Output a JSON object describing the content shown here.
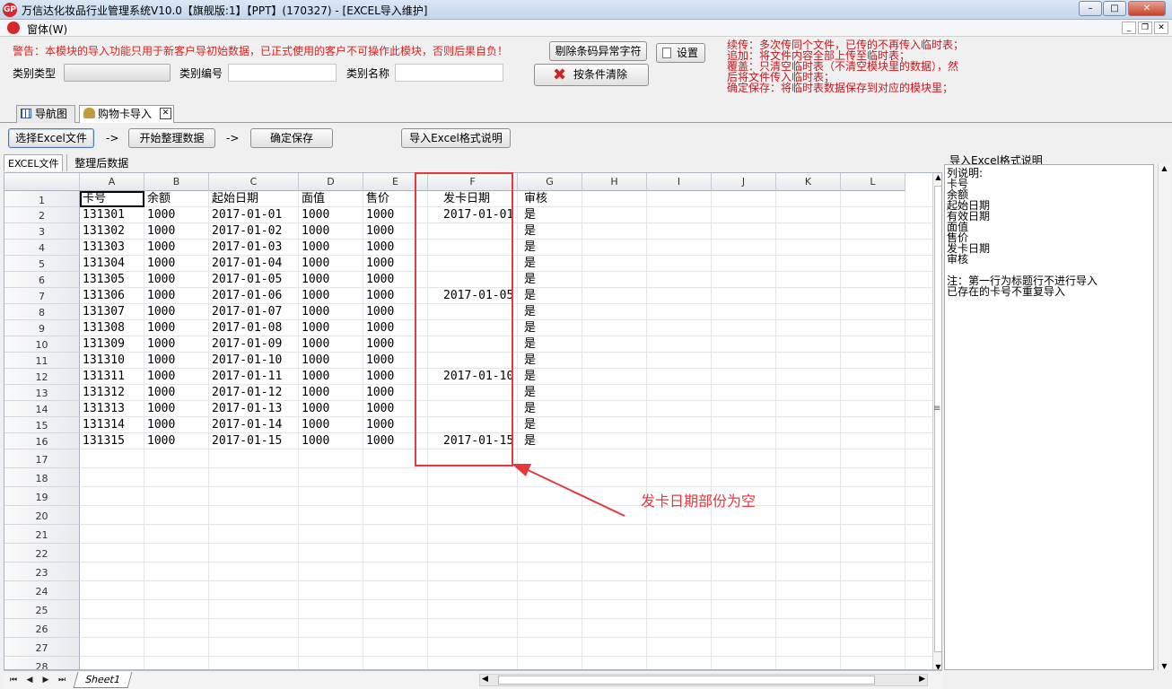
{
  "window": {
    "logo_text": "GP",
    "title": "万信达化妆品行业管理系统V10.0【旗舰版:1】【PPT】(170327) - [EXCEL导入维护]",
    "min": "–",
    "max": "□",
    "close": "✕"
  },
  "menubar": {
    "item": "窗体(W)",
    "mdi_min": "_",
    "mdi_restore": "❐",
    "mdi_close": "✕"
  },
  "header": {
    "warning": "警告：本模块的导入功能只用于新客户导初始数据，已正式使用的客户不可操作此模块，否则后果自负！",
    "category_type_label": "类别类型",
    "category_code_label": "类别编号",
    "category_name_label": "类别名称",
    "btn_remove_abnormal": "剔除条码异常字符",
    "btn_settings": "设置",
    "btn_clear": "按条件清除",
    "notes": [
      "续传：多次传同个文件，已传的不再传入临时表；",
      "追加：将文件内容全部上传至临时表；",
      "覆盖：只清空临时表（不清空模块里的数据），然",
      "后将文件传入临时表；",
      "确定保存：将临时表数据保存到对应的模块里；"
    ]
  },
  "tabs": [
    {
      "label": "导航图"
    },
    {
      "label": "购物卡导入"
    }
  ],
  "toolbar": {
    "select_excel": "选择Excel文件",
    "arrow1": "->",
    "start_organize": "开始整理数据",
    "arrow2": "->",
    "confirm_save": "确定保存",
    "format_help": "导入Excel格式说明"
  },
  "subtabs": {
    "excel_file": "EXCEL文件",
    "organized": "整理后数据"
  },
  "sheet": {
    "columns": [
      "A",
      "B",
      "C",
      "D",
      "E",
      "F",
      "G",
      "H",
      "I",
      "J",
      "K",
      "L"
    ],
    "row_numbers": [
      "1",
      "2",
      "3",
      "4",
      "5",
      "6",
      "7",
      "8",
      "9",
      "10",
      "11",
      "12",
      "13",
      "14",
      "15",
      "16",
      "17",
      "18",
      "19",
      "20",
      "21",
      "22",
      "23",
      "24",
      "25",
      "26",
      "27",
      "28"
    ],
    "rows": [
      [
        "卡号",
        "余额",
        "起始日期",
        "面值",
        "售价",
        "发卡日期",
        "审核"
      ],
      [
        "131301",
        "1000",
        "2017-01-01",
        "1000",
        "1000",
        "2017-01-01",
        "是"
      ],
      [
        "131302",
        "1000",
        "2017-01-02",
        "1000",
        "1000",
        "",
        "是"
      ],
      [
        "131303",
        "1000",
        "2017-01-03",
        "1000",
        "1000",
        "",
        "是"
      ],
      [
        "131304",
        "1000",
        "2017-01-04",
        "1000",
        "1000",
        "",
        "是"
      ],
      [
        "131305",
        "1000",
        "2017-01-05",
        "1000",
        "1000",
        "",
        "是"
      ],
      [
        "131306",
        "1000",
        "2017-01-06",
        "1000",
        "1000",
        "2017-01-05",
        "是"
      ],
      [
        "131307",
        "1000",
        "2017-01-07",
        "1000",
        "1000",
        "",
        "是"
      ],
      [
        "131308",
        "1000",
        "2017-01-08",
        "1000",
        "1000",
        "",
        "是"
      ],
      [
        "131309",
        "1000",
        "2017-01-09",
        "1000",
        "1000",
        "",
        "是"
      ],
      [
        "131310",
        "1000",
        "2017-01-10",
        "1000",
        "1000",
        "",
        "是"
      ],
      [
        "131311",
        "1000",
        "2017-01-11",
        "1000",
        "1000",
        "2017-01-10",
        "是"
      ],
      [
        "131312",
        "1000",
        "2017-01-12",
        "1000",
        "1000",
        "",
        "是"
      ],
      [
        "131313",
        "1000",
        "2017-01-13",
        "1000",
        "1000",
        "",
        "是"
      ],
      [
        "131314",
        "1000",
        "2017-01-14",
        "1000",
        "1000",
        "",
        "是"
      ],
      [
        "131315",
        "1000",
        "2017-01-15",
        "1000",
        "1000",
        "2017-01-15",
        "是"
      ]
    ],
    "sheet_tab": "Sheet1",
    "nav": [
      "⏮",
      "◀",
      "▶",
      "⏭"
    ]
  },
  "annotation": {
    "text": "发卡日期部份为空",
    "color": "#e4383d"
  },
  "right_panel": {
    "title": "导入Excel格式说明",
    "lines": [
      "列说明:",
      "卡号",
      "余额",
      "起始日期",
      "有效日期",
      "面值",
      "售价",
      "发卡日期",
      "审核",
      "",
      "注：第一行为标题行不进行导入",
      "    已存在的卡号不重复导入"
    ]
  },
  "colors": {
    "warning_red": "#e0201c",
    "note_red": "#c8161d",
    "highlight_box": "#e7383b"
  }
}
